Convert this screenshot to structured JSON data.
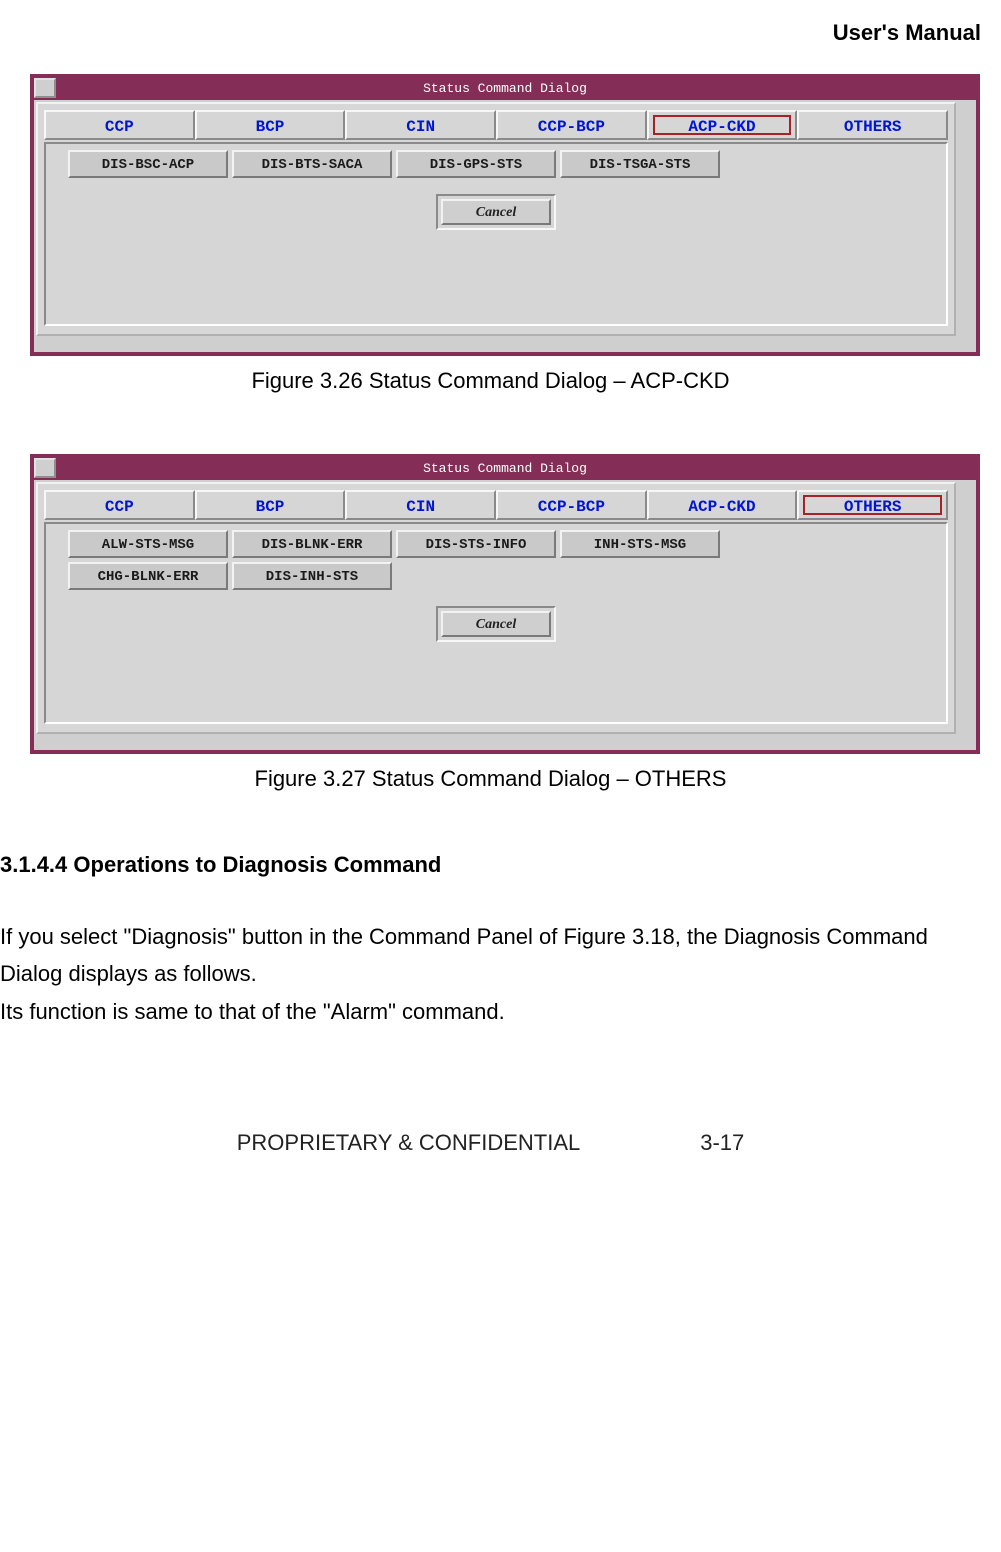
{
  "header": {
    "title": "User's Manual"
  },
  "dialog1": {
    "title": "Status Command Dialog",
    "tabs": [
      "CCP",
      "BCP",
      "CIN",
      "CCP-BCP",
      "ACP-CKD",
      "OTHERS"
    ],
    "selected_tab_index": 4,
    "rows": [
      [
        "DIS-BSC-ACP",
        "DIS-BTS-SACA",
        "DIS-GPS-STS",
        "DIS-TSGA-STS"
      ]
    ],
    "cancel": "Cancel",
    "caption": "Figure 3.26 Status Command Dialog – ACP-CKD"
  },
  "dialog2": {
    "title": "Status Command Dialog",
    "tabs": [
      "CCP",
      "BCP",
      "CIN",
      "CCP-BCP",
      "ACP-CKD",
      "OTHERS"
    ],
    "selected_tab_index": 5,
    "rows": [
      [
        "ALW-STS-MSG",
        "DIS-BLNK-ERR",
        "DIS-STS-INFO",
        "INH-STS-MSG"
      ],
      [
        "CHG-BLNK-ERR",
        "DIS-INH-STS"
      ]
    ],
    "cancel": "Cancel",
    "caption": "Figure 3.27 Status Command Dialog – OTHERS"
  },
  "section": {
    "heading": "3.1.4.4 Operations to Diagnosis Command",
    "para1": "If you select \"Diagnosis\" button in the Command Panel of Figure 3.18, the Diagnosis Command Dialog displays as follows.",
    "para2": "Its function is same to that of the \"Alarm\" command."
  },
  "footer": {
    "left": "PROPRIETARY & CONFIDENTIAL",
    "right": "3-17"
  }
}
